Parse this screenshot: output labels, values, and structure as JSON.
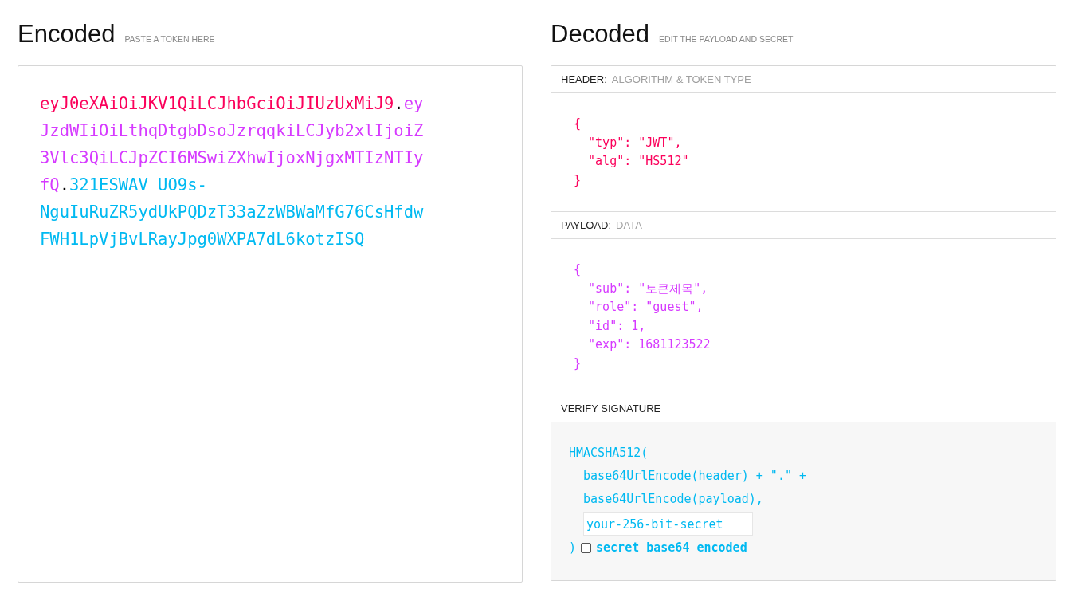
{
  "encoded": {
    "title": "Encoded",
    "subtitle": "PASTE A TOKEN HERE",
    "token_lines": [
      [
        {
          "kind": "header",
          "text": "eyJ0eXAiOiJKV1QiLCJhbGciOiJIUzUxMiJ9"
        },
        {
          "kind": "dot",
          "text": "."
        },
        {
          "kind": "payload",
          "text": "ey"
        }
      ],
      [
        {
          "kind": "payload",
          "text": "JzdWIiOiLthqDtgbDsoJzrqqkiLCJyb2xlIjoiZ"
        }
      ],
      [
        {
          "kind": "payload",
          "text": "3Vlc3QiLCJpZCI6MSwiZXhwIjoxNjgxMTIzNTIy"
        }
      ],
      [
        {
          "kind": "payload",
          "text": "fQ"
        },
        {
          "kind": "dot",
          "text": "."
        },
        {
          "kind": "signature",
          "text": "321ESWAV_UO9s-"
        }
      ],
      [
        {
          "kind": "signature",
          "text": "NguIuRuZR5ydUkPQDzT33aZzWBWaMfG76CsHfdw"
        }
      ],
      [
        {
          "kind": "signature",
          "text": "FWH1LpVjBvLRayJpg0WXPA7dL6kotzISQ"
        }
      ]
    ]
  },
  "decoded": {
    "title": "Decoded",
    "subtitle": "EDIT THE PAYLOAD AND SECRET",
    "sections": [
      {
        "kind": "header",
        "label": "HEADER:",
        "sublabel": "ALGORITHM & TOKEN TYPE",
        "code": "{\n  \"typ\": \"JWT\",\n  \"alg\": \"HS512\"\n}"
      },
      {
        "kind": "payload",
        "label": "PAYLOAD:",
        "sublabel": "DATA",
        "code": "{\n  \"sub\": \"토큰제목\",\n  \"role\": \"guest\",\n  \"id\": 1,\n  \"exp\": 1681123522\n}"
      },
      {
        "kind": "signature",
        "label": "VERIFY SIGNATURE",
        "code": "HMACSHA512(\n  base64UrlEncode(header) + \".\" +\n  base64UrlEncode(payload),",
        "secret_value": "your-256-bit-secret",
        "closing": ")",
        "checkbox_label": "secret base64 encoded",
        "checked": false
      }
    ]
  }
}
